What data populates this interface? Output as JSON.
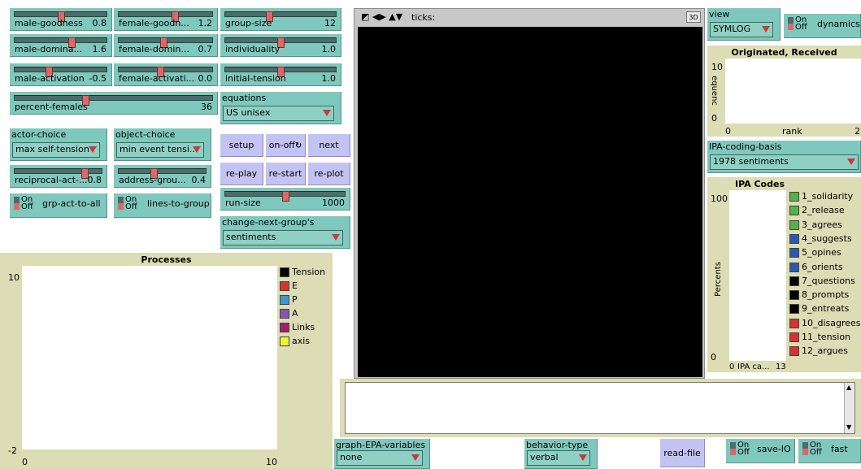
{
  "sliders": [
    {
      "id": "male-goodness",
      "label": "male-goodness",
      "value": "0.8",
      "frac": 0.5
    },
    {
      "id": "female-goodness",
      "label": "female-goodn...",
      "value": "1.2",
      "frac": 0.6
    },
    {
      "id": "male-dominance",
      "label": "male-domina...",
      "value": "1.6",
      "frac": 0.62
    },
    {
      "id": "female-dominance",
      "label": "female-domin...",
      "value": "0.7",
      "frac": 0.48
    },
    {
      "id": "male-activation",
      "label": "male-activation",
      "value": "-0.5",
      "frac": 0.37
    },
    {
      "id": "female-activation",
      "label": "female-activati...",
      "value": "0.0",
      "frac": 0.44
    },
    {
      "id": "percent-females",
      "label": "percent-females",
      "value": "36",
      "frac": 0.36
    },
    {
      "id": "reciprocal-act",
      "label": "reciprocal-act-...",
      "value": "0.8",
      "frac": 0.8
    },
    {
      "id": "address-group",
      "label": "address-grou...",
      "value": "0.4",
      "frac": 0.4
    },
    {
      "id": "group-size",
      "label": "group-size",
      "value": "12",
      "frac": 0.4
    },
    {
      "id": "individuality",
      "label": "individuality",
      "value": "1.0",
      "frac": 0.5
    },
    {
      "id": "initial-tension",
      "label": "initial-tension",
      "value": "1.0",
      "frac": 0.5
    },
    {
      "id": "run-size",
      "label": "run-size",
      "value": "1000",
      "frac": 0.5
    }
  ],
  "choosers": {
    "equations": {
      "label": "equations",
      "value": "US unisex"
    },
    "actor_choice": {
      "label": "actor-choice",
      "value": "max self-tension"
    },
    "object_choice": {
      "label": "object-choice",
      "value": "min event tensi..."
    },
    "change_next_group": {
      "label": "change-next-group's",
      "value": "sentiments"
    },
    "view": {
      "label": "view",
      "value": "SYMLOG"
    },
    "ipa_coding_basis": {
      "label": "IPA-coding-basis",
      "value": "1978 sentiments"
    },
    "graph_epa": {
      "label": "graph-EPA-variables",
      "value": "none"
    },
    "behavior_type": {
      "label": "behavior-type",
      "value": "verbal"
    }
  },
  "switches": {
    "grp_act_to_all": {
      "label": "grp-act-to-all",
      "on": "On",
      "off": "Off",
      "state": "off"
    },
    "lines_to_group": {
      "label": "lines-to-group",
      "on": "On",
      "off": "Off",
      "state": "off"
    },
    "dynamics": {
      "label": "dynamics",
      "on": "On",
      "off": "Off",
      "state": "off"
    },
    "save_io": {
      "label": "save-IO",
      "on": "On",
      "off": "Off",
      "state": "off"
    },
    "fast": {
      "label": "fast",
      "on": "On",
      "off": "Off",
      "state": "off"
    }
  },
  "buttons": {
    "setup": "setup",
    "on_off": "on-off",
    "next": "next",
    "replay": "re-play",
    "restart": "re-start",
    "replot": "re-plot",
    "read_file": "read-file"
  },
  "world": {
    "ticks_label": "ticks:",
    "btn_3d": "3D"
  },
  "processes_plot": {
    "title": "Processes",
    "y_max": "10",
    "y_min": "-2",
    "x_min": "0",
    "x_max": "10",
    "legend": [
      {
        "name": "Tension",
        "color": "#000000"
      },
      {
        "name": "E",
        "color": "#d7322e"
      },
      {
        "name": "P",
        "color": "#3c97d4"
      },
      {
        "name": "A",
        "color": "#8a54ad"
      },
      {
        "name": "Links",
        "color": "#a1216e"
      },
      {
        "name": "axis",
        "color": "#f1f13a"
      }
    ]
  },
  "originated_plot": {
    "title": "Originated, Received",
    "y_max": "10",
    "y_min": "0",
    "x_min": "0",
    "x_max": "2",
    "ylabel": "equenc",
    "xlabel": "rank"
  },
  "ipa_plot": {
    "title": "IPA Codes",
    "y_max": "100",
    "y_min": "0",
    "ylabel": "Percents",
    "xlabel": "IPA ca...",
    "x_max": "13",
    "x_min": "0",
    "legend": [
      {
        "name": "1_solidarity",
        "color": "#58b04c"
      },
      {
        "name": "2_release",
        "color": "#58b04c"
      },
      {
        "name": "3_agrees",
        "color": "#58b04c"
      },
      {
        "name": "4_suggests",
        "color": "#2b59b2"
      },
      {
        "name": "5_opines",
        "color": "#2b59b2"
      },
      {
        "name": "6_orients",
        "color": "#2b59b2"
      },
      {
        "name": "7_questions",
        "color": "#000000"
      },
      {
        "name": "8_prompts",
        "color": "#000000"
      },
      {
        "name": "9_entreats",
        "color": "#000000"
      },
      {
        "name": "10_disagrees",
        "color": "#d7322e"
      },
      {
        "name": "11_tension",
        "color": "#d7322e"
      },
      {
        "name": "12_argues",
        "color": "#d7322e"
      }
    ]
  }
}
